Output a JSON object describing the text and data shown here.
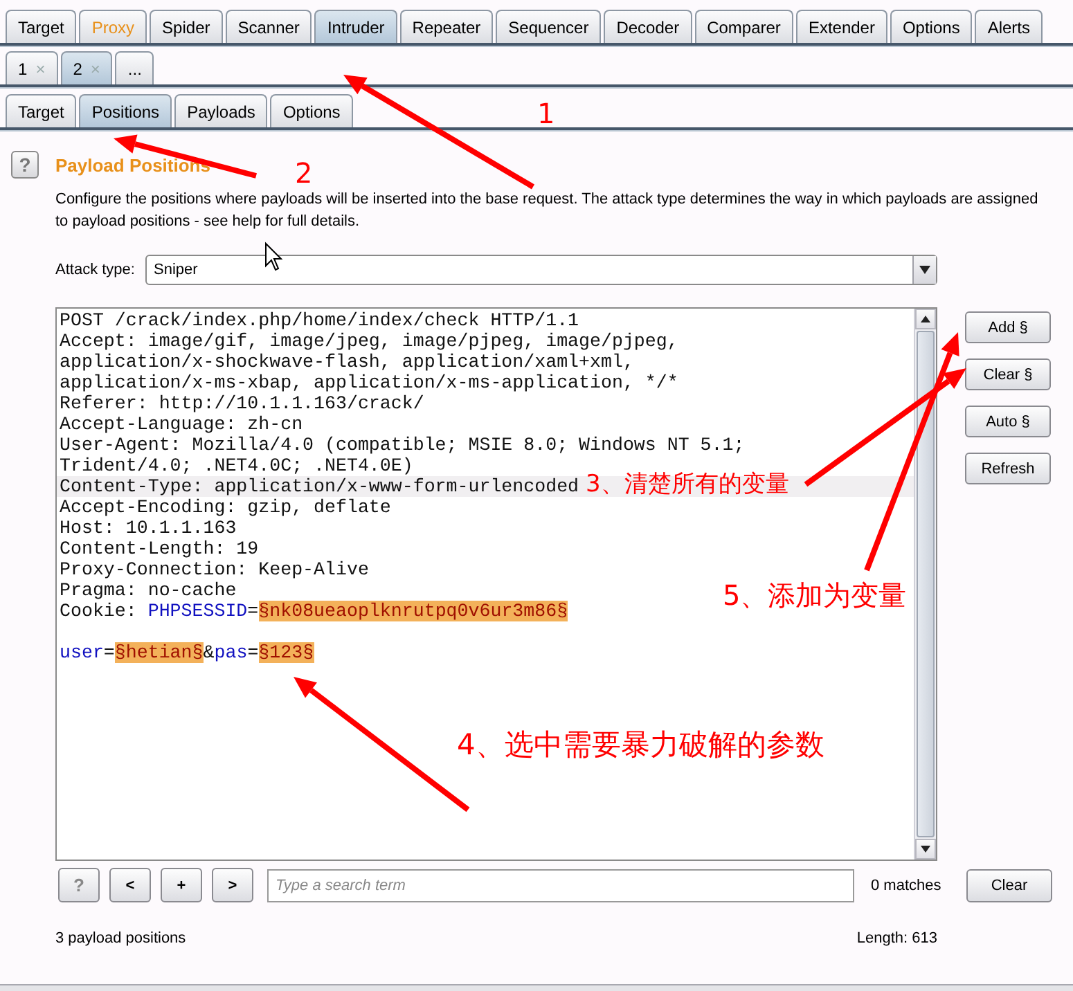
{
  "main_tabs": [
    {
      "label": "Target",
      "selected": false,
      "highlighted": false
    },
    {
      "label": "Proxy",
      "selected": false,
      "highlighted": true
    },
    {
      "label": "Spider",
      "selected": false,
      "highlighted": false
    },
    {
      "label": "Scanner",
      "selected": false,
      "highlighted": false
    },
    {
      "label": "Intruder",
      "selected": true,
      "highlighted": false
    },
    {
      "label": "Repeater",
      "selected": false,
      "highlighted": false
    },
    {
      "label": "Sequencer",
      "selected": false,
      "highlighted": false
    },
    {
      "label": "Decoder",
      "selected": false,
      "highlighted": false
    },
    {
      "label": "Comparer",
      "selected": false,
      "highlighted": false
    },
    {
      "label": "Extender",
      "selected": false,
      "highlighted": false
    },
    {
      "label": "Options",
      "selected": false,
      "highlighted": false
    },
    {
      "label": "Alerts",
      "selected": false,
      "highlighted": false
    }
  ],
  "attack_tabs": [
    {
      "label": "1",
      "close": "×",
      "selected": false
    },
    {
      "label": "2",
      "close": "×",
      "selected": true
    },
    {
      "label": "...",
      "selected": false
    }
  ],
  "sub_tabs": [
    {
      "label": "Target",
      "selected": false
    },
    {
      "label": "Positions",
      "selected": true
    },
    {
      "label": "Payloads",
      "selected": false
    },
    {
      "label": "Options",
      "selected": false
    }
  ],
  "help_button": "?",
  "section_title": "Payload Positions",
  "description": "Configure the positions where payloads will be inserted into the base request. The attack type determines the way in which payloads are assigned to payload positions - see help for full details.",
  "attack_type": {
    "label": "Attack type:",
    "value": "Sniper"
  },
  "request_lines": [
    {
      "kind": "code",
      "current": false,
      "segments": [
        {
          "kind": "plain",
          "text": "POST /crack/index.php/home/index/check HTTP/1.1"
        }
      ]
    },
    {
      "kind": "code",
      "current": false,
      "segments": [
        {
          "kind": "plain",
          "text": "Accept: image/gif, image/jpeg, image/pjpeg, image/pjpeg,"
        }
      ]
    },
    {
      "kind": "code",
      "current": false,
      "segments": [
        {
          "kind": "plain",
          "text": "application/x-shockwave-flash, application/xaml+xml,"
        }
      ]
    },
    {
      "kind": "code",
      "current": false,
      "segments": [
        {
          "kind": "plain",
          "text": "application/x-ms-xbap, application/x-ms-application, */*"
        }
      ]
    },
    {
      "kind": "code",
      "current": false,
      "segments": [
        {
          "kind": "plain",
          "text": "Referer: http://10.1.1.163/crack/"
        }
      ]
    },
    {
      "kind": "code",
      "current": false,
      "segments": [
        {
          "kind": "plain",
          "text": "Accept-Language: zh-cn"
        }
      ]
    },
    {
      "kind": "code",
      "current": false,
      "segments": [
        {
          "kind": "plain",
          "text": "User-Agent: Mozilla/4.0 (compatible; MSIE 8.0; Windows NT 5.1;"
        }
      ]
    },
    {
      "kind": "code",
      "current": false,
      "segments": [
        {
          "kind": "plain",
          "text": "Trident/4.0; .NET4.0C; .NET4.0E)"
        }
      ]
    },
    {
      "kind": "code",
      "current": true,
      "segments": [
        {
          "kind": "plain",
          "text": "Content-Type: application/x-www-form-urlencoded"
        }
      ]
    },
    {
      "kind": "code",
      "current": false,
      "segments": [
        {
          "kind": "plain",
          "text": "Accept-Encoding: gzip, deflate"
        }
      ]
    },
    {
      "kind": "code",
      "current": false,
      "segments": [
        {
          "kind": "plain",
          "text": "Host: 10.1.1.163"
        }
      ]
    },
    {
      "kind": "code",
      "current": false,
      "segments": [
        {
          "kind": "plain",
          "text": "Content-Length: 19"
        }
      ]
    },
    {
      "kind": "code",
      "current": false,
      "segments": [
        {
          "kind": "plain",
          "text": "Proxy-Connection: Keep-Alive"
        }
      ]
    },
    {
      "kind": "code",
      "current": false,
      "segments": [
        {
          "kind": "plain",
          "text": "Pragma: no-cache"
        }
      ]
    },
    {
      "kind": "code",
      "current": false,
      "segments": [
        {
          "kind": "plain",
          "text": "Cookie: "
        },
        {
          "kind": "name",
          "text": "PHPSESSID"
        },
        {
          "kind": "plain",
          "text": "="
        },
        {
          "kind": "payload",
          "text": "§nk08ueaoplknrutpq0v6ur3m86§"
        }
      ]
    },
    {
      "kind": "blank",
      "current": false
    },
    {
      "kind": "code",
      "current": false,
      "segments": [
        {
          "kind": "name",
          "text": "user"
        },
        {
          "kind": "plain",
          "text": "="
        },
        {
          "kind": "payload",
          "text": "§hetian§"
        },
        {
          "kind": "plain",
          "text": "&"
        },
        {
          "kind": "name",
          "text": "pas"
        },
        {
          "kind": "plain",
          "text": "="
        },
        {
          "kind": "payload",
          "text": "§123§"
        }
      ]
    }
  ],
  "side_buttons": [
    "Add §",
    "Clear §",
    "Auto §",
    "Refresh"
  ],
  "search_bar": {
    "buttons": [
      "?",
      "<",
      "+",
      ">"
    ],
    "placeholder": "Type a search term",
    "matches": "0 matches",
    "clear": "Clear"
  },
  "status": {
    "positions": "3 payload positions",
    "length": "Length: 613"
  },
  "annotations": [
    "1",
    "2",
    "3、清楚所有的变量",
    "5、添加为变量",
    "4、选中需要暴力破解的参数"
  ]
}
